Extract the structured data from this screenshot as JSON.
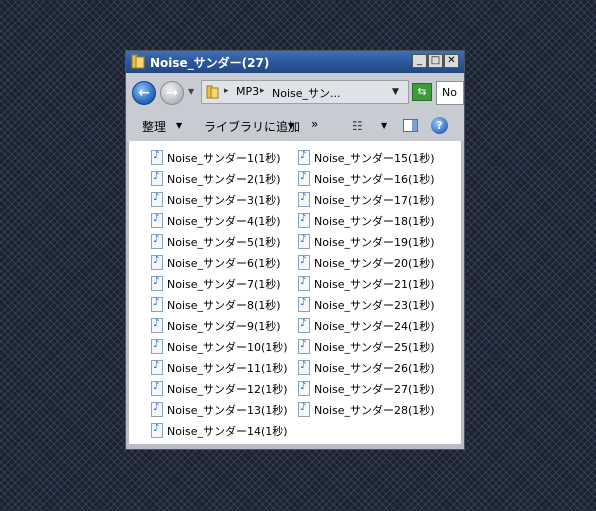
{
  "window": {
    "title": "Noise_サンダー(27)",
    "minimize": "_",
    "maximize": "□",
    "close": "✕"
  },
  "navigation": {
    "back": "←",
    "forward": "→",
    "history_dropdown": "▼",
    "breadcrumb": [
      "MP3",
      "Noise_サン..."
    ],
    "separator": "▸",
    "address_dropdown": "▼",
    "refresh": "⇆",
    "search_text": "No"
  },
  "toolbar": {
    "organize": "整理",
    "organize_dropdown": "▼",
    "add_to_library": "ライブラリに追加",
    "add_to_library_dropdown": "▼",
    "more": "»",
    "view_icon": "☷",
    "view_dropdown": "▼",
    "help": "?"
  },
  "files": {
    "column1": [
      "Noise_サンダー1(1秒)",
      "Noise_サンダー2(1秒)",
      "Noise_サンダー3(1秒)",
      "Noise_サンダー4(1秒)",
      "Noise_サンダー5(1秒)",
      "Noise_サンダー6(1秒)",
      "Noise_サンダー7(1秒)",
      "Noise_サンダー8(1秒)",
      "Noise_サンダー9(1秒)",
      "Noise_サンダー10(1秒)",
      "Noise_サンダー11(1秒)",
      "Noise_サンダー12(1秒)",
      "Noise_サンダー13(1秒)",
      "Noise_サンダー14(1秒)"
    ],
    "column2": [
      "Noise_サンダー15(1秒)",
      "Noise_サンダー16(1秒)",
      "Noise_サンダー17(1秒)",
      "Noise_サンダー18(1秒)",
      "Noise_サンダー19(1秒)",
      "Noise_サンダー20(1秒)",
      "Noise_サンダー21(1秒)",
      "Noise_サンダー23(1秒)",
      "Noise_サンダー24(1秒)",
      "Noise_サンダー25(1秒)",
      "Noise_サンダー26(1秒)",
      "Noise_サンダー27(1秒)",
      "Noise_サンダー28(1秒)"
    ]
  },
  "icons": {
    "folder": "folder-icon",
    "audio_file": "audio-file-icon"
  },
  "colors": {
    "titlebar": "#2a5598",
    "desktop": "#1b2230",
    "audio_note": "#1d66c9"
  }
}
